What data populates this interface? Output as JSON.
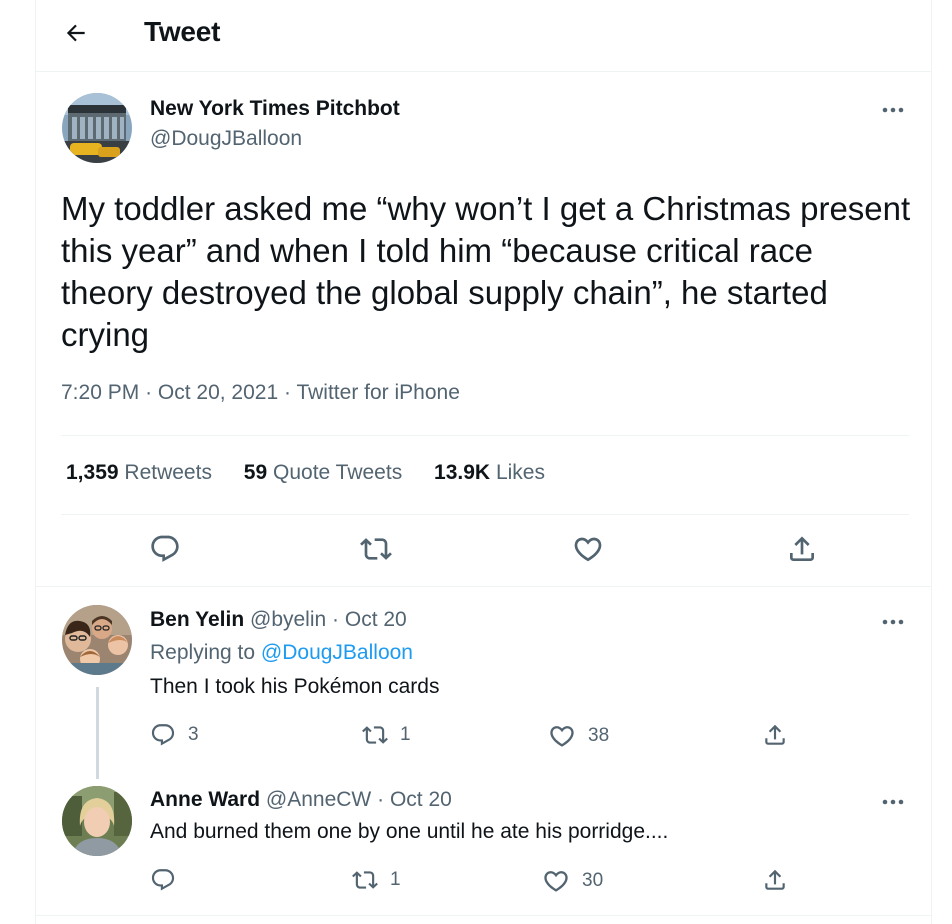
{
  "header": {
    "title": "Tweet"
  },
  "tweet": {
    "author_name": "New York Times Pitchbot",
    "author_handle": "@DougJBalloon",
    "text": "My toddler asked me “why won’t I get a Christmas present this year” and when I told him “because critical race theory destroyed the global supply chain”, he started crying",
    "time": "7:20 PM",
    "date": "Oct 20, 2021",
    "source": "Twitter for iPhone",
    "retweets_count": "1,359",
    "retweets_label": "Retweets",
    "quotes_count": "59",
    "quotes_label": "Quote Tweets",
    "likes_count": "13.9K",
    "likes_label": "Likes"
  },
  "replies": [
    {
      "name": "Ben Yelin",
      "handle": "@byelin",
      "date": "Oct 20",
      "replying_prefix": "Replying to",
      "replying_to": "@DougJBalloon",
      "text": "Then I took his Pokémon cards",
      "reply_count": "3",
      "retweet_count": "1",
      "like_count": "38"
    },
    {
      "name": "Anne Ward",
      "handle": "@AnneCW",
      "date": "Oct 20",
      "text": "And burned them one by one until he ate his porridge....",
      "retweet_count": "1",
      "like_count": "30"
    }
  ],
  "separators": {
    "dot": "·"
  },
  "icons": [
    "back-arrow-icon",
    "more-icon",
    "reply-icon",
    "retweet-icon",
    "like-icon",
    "share-icon"
  ],
  "colors": {
    "link": "#1d9bf0",
    "muted": "#536471",
    "text": "#0f1419",
    "border": "#eff3f4"
  }
}
